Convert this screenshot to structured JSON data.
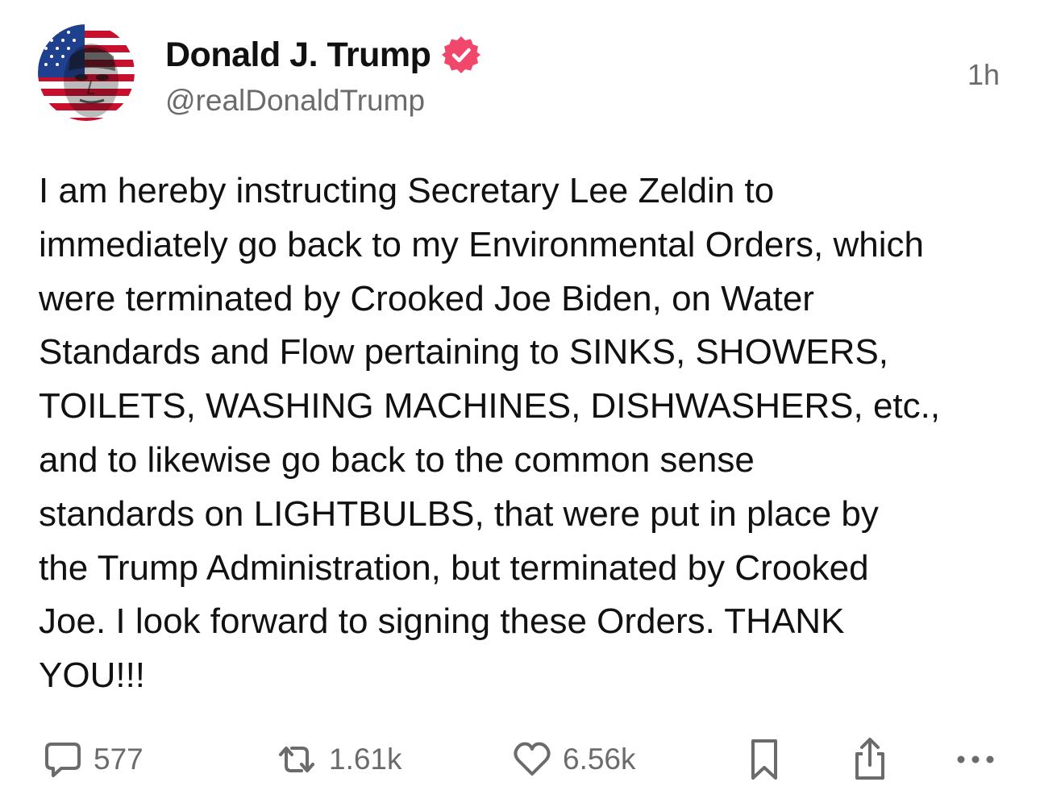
{
  "post": {
    "author": {
      "display_name": "Donald J. Trump",
      "handle": "@realDonaldTrump",
      "verified": true,
      "avatar": "flag-portrait-avatar"
    },
    "timestamp": "1h",
    "text": "I am hereby instructing Secretary Lee Zeldin to\nimmediately go back to my Environmental Orders, which\nwere terminated by Crooked Joe Biden, on Water\nStandards and Flow pertaining to SINKS, SHOWERS,\nTOILETS, WASHING MACHINES, DISHWASHERS, etc.,\nand to likewise go back to the common sense\nstandards on LIGHTBULBS, that were put in place by\nthe Trump Administration, but terminated by Crooked\nJoe. I look forward to signing these Orders. THANK\nYOU!!!"
  },
  "actions": {
    "reply": {
      "icon": "reply-icon",
      "count": "577"
    },
    "repost": {
      "icon": "repost-icon",
      "count": "1.61k"
    },
    "like": {
      "icon": "heart-icon",
      "count": "6.56k"
    },
    "bookmark": {
      "icon": "bookmark-icon"
    },
    "share": {
      "icon": "share-icon"
    },
    "more": {
      "icon": "more-icon"
    }
  },
  "colors": {
    "text": "#111111",
    "muted": "#6b6b6b",
    "verified_badge": "#f0476a"
  }
}
